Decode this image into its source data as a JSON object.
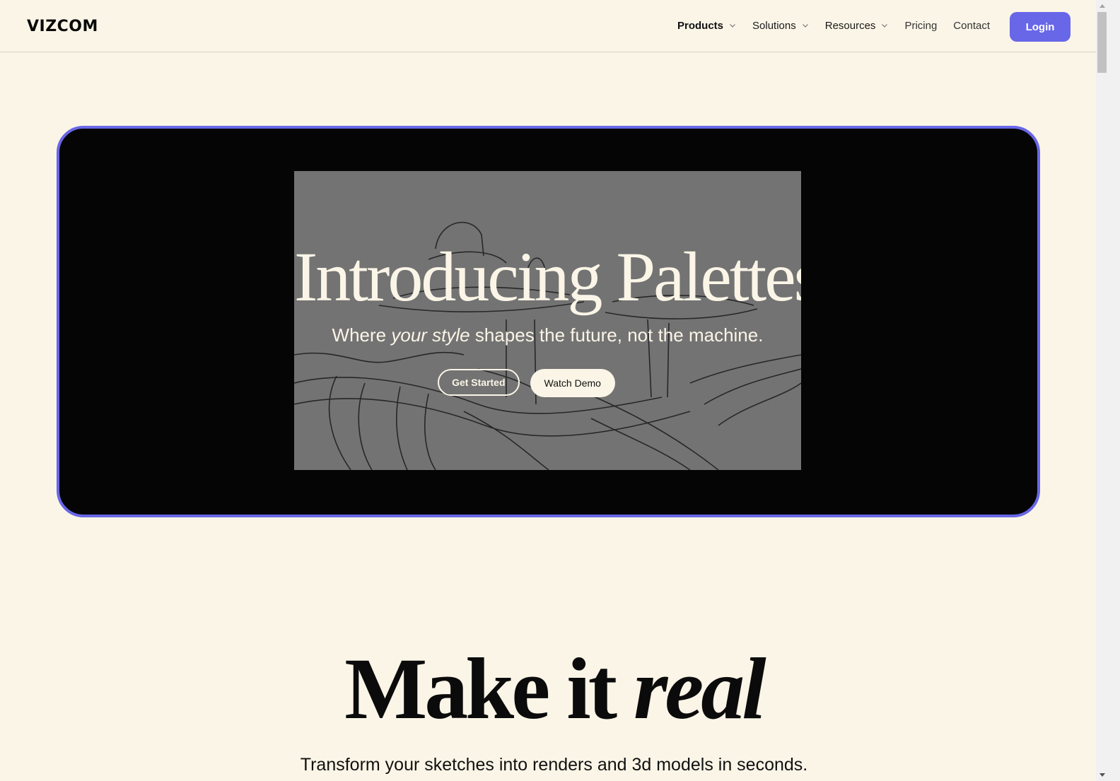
{
  "header": {
    "logo": "VIZCOM",
    "nav": [
      {
        "label": "Products",
        "has_dropdown": true,
        "icon": "chevron-down-icon"
      },
      {
        "label": "Solutions",
        "has_dropdown": true,
        "icon": "chevron-down-icon"
      },
      {
        "label": "Resources",
        "has_dropdown": true,
        "icon": "chevron-down-icon"
      },
      {
        "label": "Pricing",
        "has_dropdown": false
      },
      {
        "label": "Contact",
        "has_dropdown": false
      }
    ],
    "login_label": "Login"
  },
  "hero": {
    "title": "Introducing Palettes",
    "subtitle_before": "Where ",
    "subtitle_emphasis": "your style",
    "subtitle_after": " shapes the future, not the machine.",
    "primary_button": "Get Started",
    "secondary_button": "Watch Demo",
    "media": "sketch-video"
  },
  "section": {
    "title_plain": "Make it ",
    "title_emphasis": "real",
    "subtitle": "Transform your sketches into renders and 3d models in seconds."
  },
  "colors": {
    "background": "#fbf5e7",
    "accent": "#6867e8",
    "hero_background": "#050505",
    "video_gray": "#737373"
  }
}
